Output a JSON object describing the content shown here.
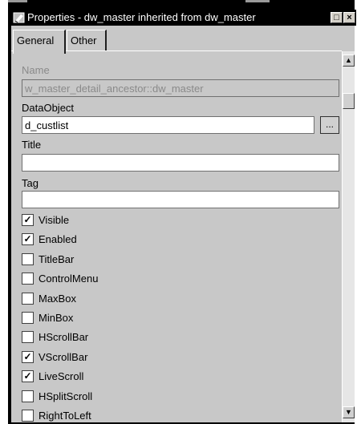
{
  "window": {
    "title": "Properties - dw_master inherited from dw_master",
    "minimize_glyph": "□",
    "close_glyph": "×",
    "app_icon": "properties-icon"
  },
  "tabs": [
    {
      "label": "General",
      "active": true
    },
    {
      "label": "Other",
      "active": false
    }
  ],
  "fields": {
    "name": {
      "label": "Name",
      "value": "w_master_detail_ancestor::dw_master",
      "enabled": false
    },
    "dataobject": {
      "label": "DataObject",
      "value": "d_custlist",
      "browse_label": "..."
    },
    "title": {
      "label": "Title",
      "value": ""
    },
    "tag": {
      "label": "Tag",
      "value": ""
    }
  },
  "checkboxes": [
    {
      "label": "Visible",
      "checked": true
    },
    {
      "label": "Enabled",
      "checked": true
    },
    {
      "label": "TitleBar",
      "checked": false
    },
    {
      "label": "ControlMenu",
      "checked": false
    },
    {
      "label": "MaxBox",
      "checked": false
    },
    {
      "label": "MinBox",
      "checked": false
    },
    {
      "label": "HScrollBar",
      "checked": false
    },
    {
      "label": "VScrollBar",
      "checked": true
    },
    {
      "label": "LiveScroll",
      "checked": true
    },
    {
      "label": "HSplitScroll",
      "checked": false
    },
    {
      "label": "RightToLeft",
      "checked": false
    }
  ],
  "scrollbar": {
    "up_glyph": "▲",
    "down_glyph": "▼",
    "position": 0.05
  },
  "colors": {
    "titlebar": "#000000",
    "panel": "#c8c8c8",
    "field": "#ffffff"
  }
}
